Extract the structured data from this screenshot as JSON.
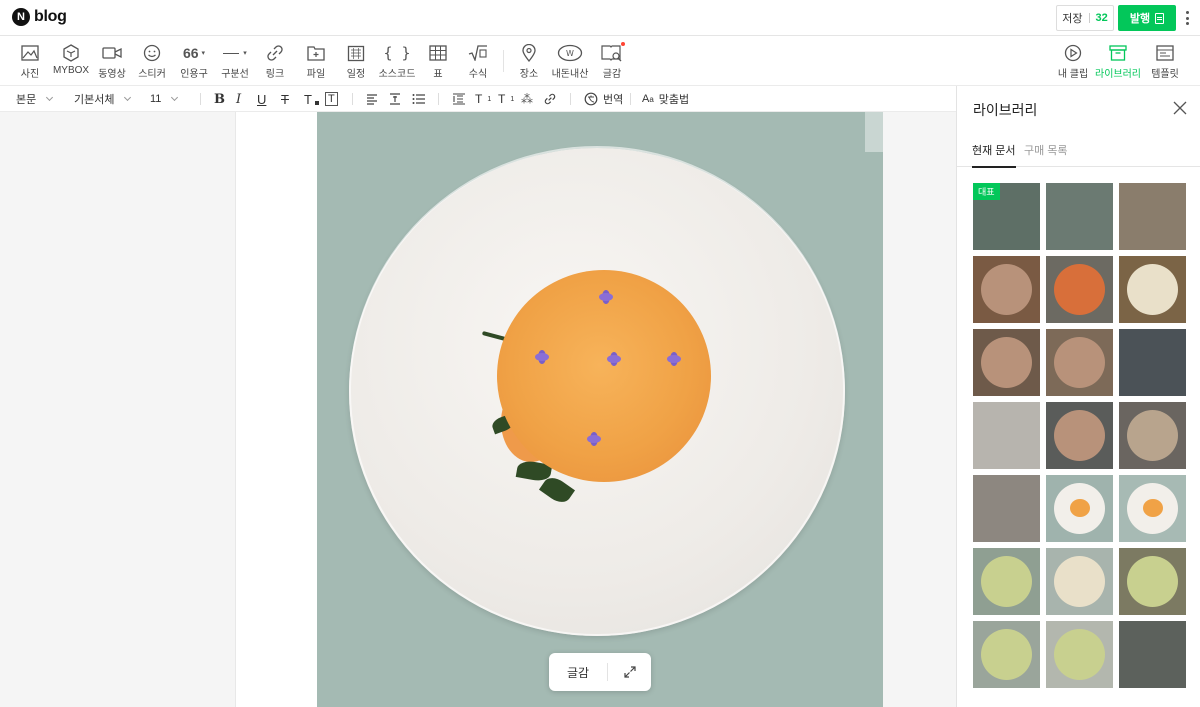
{
  "header": {
    "logo_letter": "N",
    "logo_text": "blog",
    "save_label": "저장",
    "save_count": "32",
    "publish_label": "발행"
  },
  "insert_toolbar": {
    "photo": "사진",
    "mybox": "MYBOX",
    "video": "동영상",
    "sticker": "스티커",
    "quote": "인용구",
    "divider": "구분선",
    "link": "링크",
    "file": "파일",
    "schedule": "일정",
    "source_code": "소스코드",
    "table": "표",
    "formula": "수식",
    "place": "장소",
    "my_products": "내돈내산",
    "writing_material": "글감",
    "my_clip": "내 클립",
    "library": "라이브러리",
    "template": "템플릿"
  },
  "format_toolbar": {
    "paragraph_style": "본문",
    "font_family": "기본서체",
    "font_size": "11",
    "translate": "번역",
    "spellcheck": "맞춤법"
  },
  "editor": {
    "floating_material_label": "글감"
  },
  "library_panel": {
    "title": "라이브러리",
    "tabs": [
      "현재 문서",
      "구매 목록"
    ],
    "representative_badge": "대표",
    "thumbnails": [
      {
        "bg": "#5e6f66",
        "style": "interior"
      },
      {
        "bg": "#6b7a72",
        "style": "interior"
      },
      {
        "bg": "#8a7d6c",
        "style": "interior"
      },
      {
        "bg": "#7a5a43",
        "style": "food"
      },
      {
        "bg": "#6c6a62",
        "style": "fries"
      },
      {
        "bg": "#7b6446",
        "style": "pasta"
      },
      {
        "bg": "#6e5a4a",
        "style": "food"
      },
      {
        "bg": "#7d6a58",
        "style": "food"
      },
      {
        "bg": "#4b5257",
        "style": "dark"
      },
      {
        "bg": "#b7b4ae",
        "style": "light"
      },
      {
        "bg": "#5a5c5a",
        "style": "food"
      },
      {
        "bg": "#6a6560",
        "style": "cake"
      },
      {
        "bg": "#8d8780",
        "style": "interior"
      },
      {
        "bg": "#9fb3ad",
        "style": "plate"
      },
      {
        "bg": "#a7bab4",
        "style": "plate"
      },
      {
        "bg": "#8f9f92",
        "style": "pizza"
      },
      {
        "bg": "#a8b4ad",
        "style": "pasta"
      },
      {
        "bg": "#7c7a62",
        "style": "pizza"
      },
      {
        "bg": "#9aa59b",
        "style": "pizza"
      },
      {
        "bg": "#b3b7ae",
        "style": "pizza"
      },
      {
        "bg": "#5c615c",
        "style": "dark"
      }
    ]
  },
  "colors": {
    "accent": "#03c75a",
    "table_surface": "#a4bab3",
    "sauce": "#f0a246"
  }
}
